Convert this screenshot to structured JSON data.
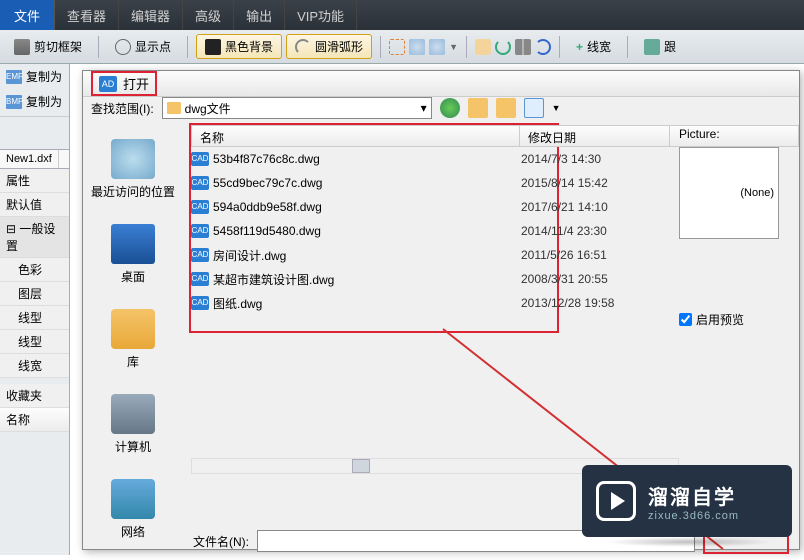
{
  "menubar": {
    "file": "文件",
    "items": [
      "查看器",
      "编辑器",
      "高级",
      "输出",
      "VIP功能"
    ]
  },
  "toolbar": {
    "crop": "剪切框架",
    "showpoint": "显示点",
    "blackbg": "黑色背景",
    "smootharc": "圆滑弧形",
    "linewidth": "线宽",
    "follow_truncated": "跟"
  },
  "leftpanel": {
    "copyas_emf": "复制为",
    "copyas_bmp": "复制为",
    "emf": "EMF",
    "bmp": "BMP",
    "doc_tab": "New1.dxf",
    "props": "属性",
    "default": "默认值",
    "general": "一般设置",
    "items": [
      "色彩",
      "图层",
      "线型",
      "线型",
      "线宽"
    ],
    "favorites": "收藏夹",
    "name_hdr": "名称"
  },
  "dialog": {
    "title": "打开",
    "search_label": "查找范围(I):",
    "folder": "dwg文件",
    "places": [
      {
        "label": "最近访问的位置"
      },
      {
        "label": "桌面"
      },
      {
        "label": "库"
      },
      {
        "label": "计算机"
      },
      {
        "label": "网络"
      }
    ],
    "columns": {
      "name": "名称",
      "date": "修改日期"
    },
    "files": [
      {
        "name": "53b4f87c76c8c.dwg",
        "date": "2014/7/3 14:30"
      },
      {
        "name": "55cd9bec79c7c.dwg",
        "date": "2015/8/14 15:42"
      },
      {
        "name": "594a0ddb9e58f.dwg",
        "date": "2017/6/21 14:10"
      },
      {
        "name": "5458f119d5480.dwg",
        "date": "2014/11/4 23:30"
      },
      {
        "name": "房间设计.dwg",
        "date": "2011/5/26 16:51"
      },
      {
        "name": "某超市建筑设计图.dwg",
        "date": "2008/3/31 20:55"
      },
      {
        "name": "图纸.dwg",
        "date": "2013/12/28 19:58"
      }
    ],
    "preview_label": "Picture:",
    "preview_none": "(None)",
    "enable_preview": "启用预览",
    "filename_label": "文件名(N):",
    "cad_badge": "CAD"
  },
  "watermark": {
    "brand": "溜溜自学",
    "url": "zixue.3d66.com"
  },
  "colors": {
    "accent_red": "#d23030",
    "cad_blue": "#2a7fd4"
  }
}
